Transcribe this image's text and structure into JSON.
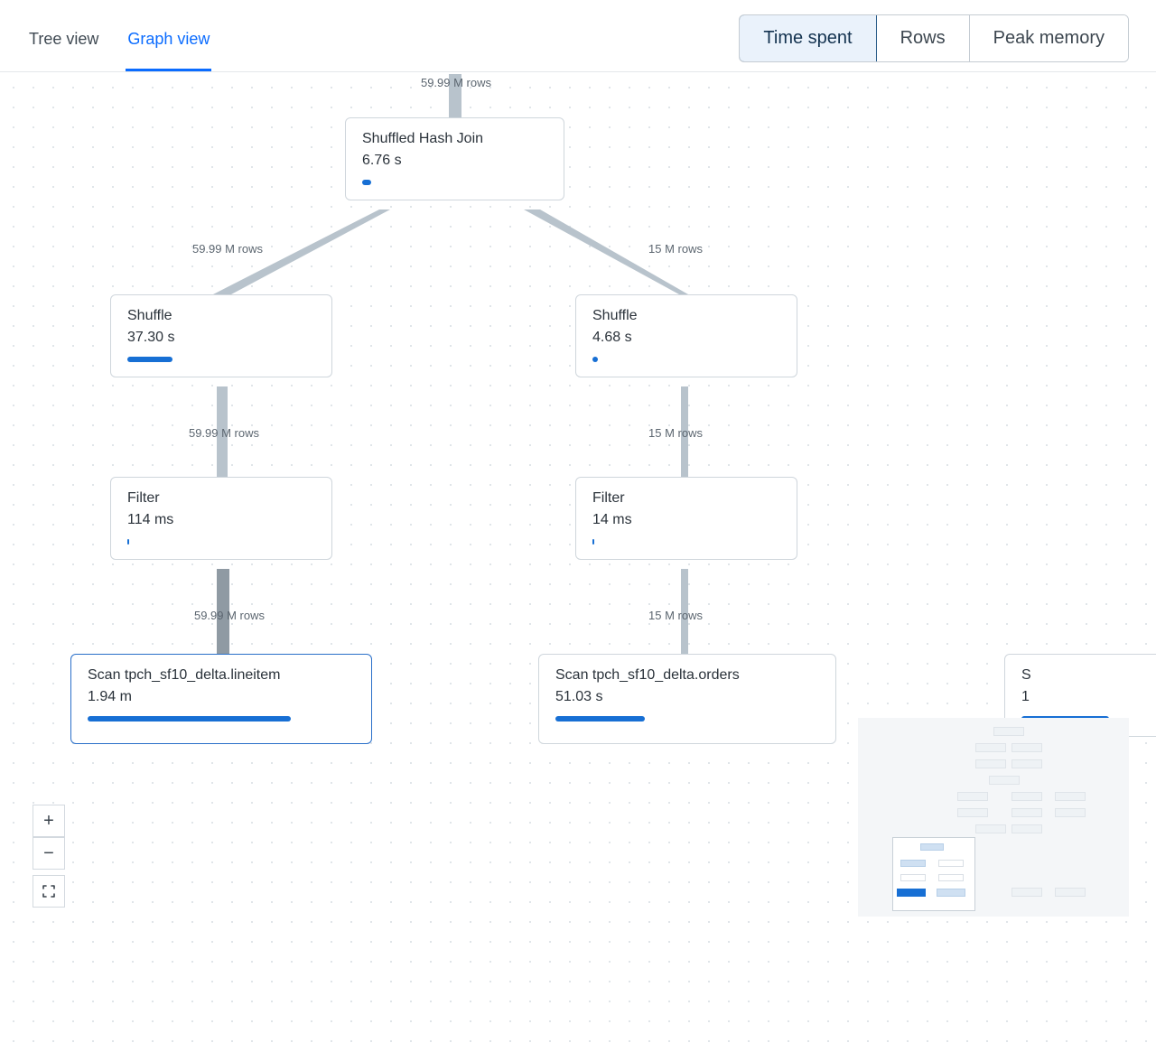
{
  "tabs": {
    "tree": "Tree view",
    "graph": "Graph view",
    "active": "graph"
  },
  "metrics": {
    "time": "Time spent",
    "rows": "Rows",
    "memory": "Peak memory",
    "active": "time"
  },
  "colors": {
    "accent": "#176fd4",
    "selected": "#2a6fc9"
  },
  "edges": {
    "top": "59.99 M rows",
    "left1": "59.99 M rows",
    "left2": "59.99 M rows",
    "left3": "59.99 M rows",
    "right1": "15 M rows",
    "right2": "15 M rows",
    "right3": "15 M rows"
  },
  "nodes": {
    "join": {
      "title": "Shuffled Hash Join",
      "metric": "6.76 s",
      "bar_pct": 5
    },
    "shufL": {
      "title": "Shuffle",
      "metric": "37.30 s",
      "bar_pct": 24
    },
    "shufR": {
      "title": "Shuffle",
      "metric": "4.68 s",
      "bar_pct": 3
    },
    "filtL": {
      "title": "Filter",
      "metric": "114 ms",
      "bar_pct": 1
    },
    "filtR": {
      "title": "Filter",
      "metric": "14 ms",
      "bar_pct": 1
    },
    "scanL": {
      "title": "Scan tpch_sf10_delta.lineitem",
      "metric": "1.94 m",
      "bar_pct": 76
    },
    "scanR": {
      "title": "Scan tpch_sf10_delta.orders",
      "metric": "51.03 s",
      "bar_pct": 34
    },
    "scanFar": {
      "title": "S",
      "metric": "1"
    }
  },
  "zoom": {
    "in": "+",
    "out": "−"
  }
}
